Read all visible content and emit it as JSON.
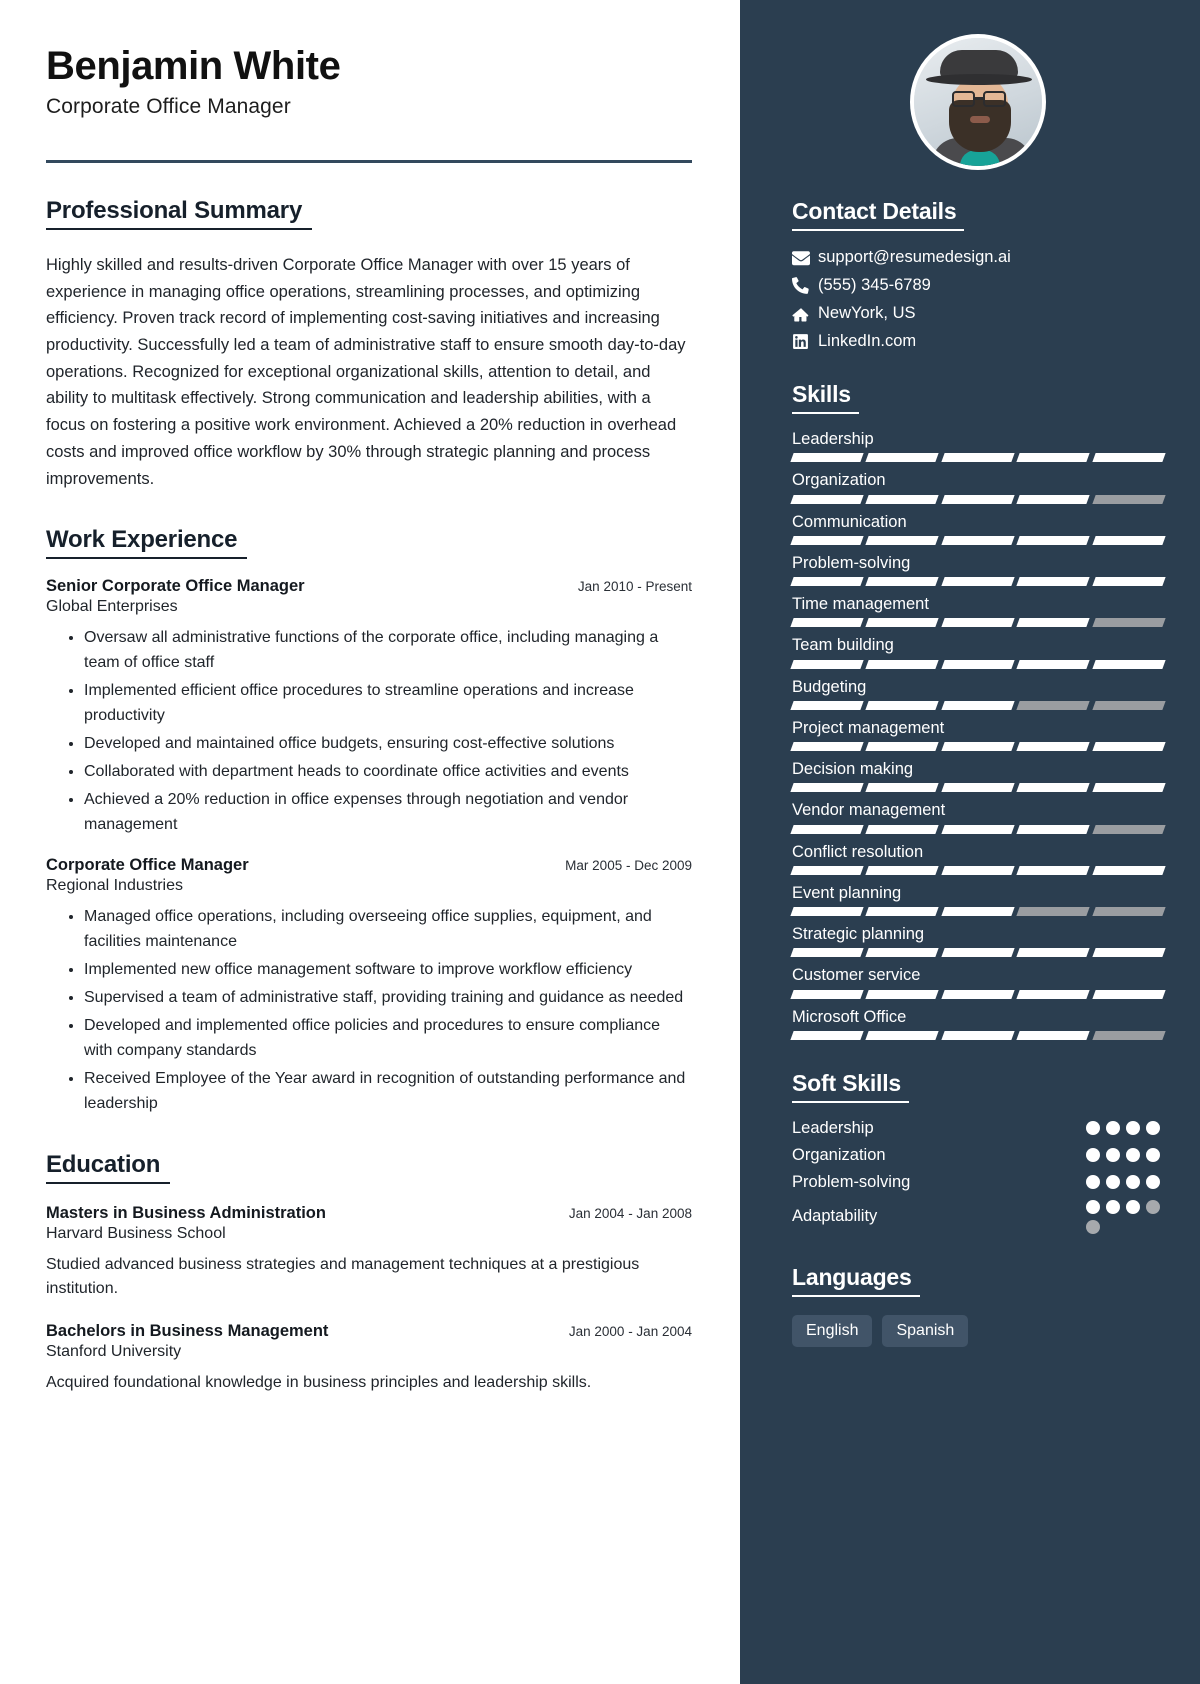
{
  "header": {
    "name": "Benjamin White",
    "job_title": "Corporate Office Manager"
  },
  "summary": {
    "title": "Professional Summary",
    "text": "Highly skilled and results-driven Corporate Office Manager with over 15 years of experience in managing office operations, streamlining processes, and optimizing efficiency. Proven track record of implementing cost-saving initiatives and increasing productivity. Successfully led a team of administrative staff to ensure smooth day-to-day operations. Recognized for exceptional organizational skills, attention to detail, and ability to multitask effectively. Strong communication and leadership abilities, with a focus on fostering a positive work environment. Achieved a 20% reduction in overhead costs and improved office workflow by 30% through strategic planning and process improvements."
  },
  "work": {
    "title": "Work Experience",
    "jobs": [
      {
        "role": "Senior Corporate Office Manager",
        "date": "Jan 2010 - Present",
        "company": "Global Enterprises",
        "bullets": [
          "Oversaw all administrative functions of the corporate office, including managing a team of office staff",
          "Implemented efficient office procedures to streamline operations and increase productivity",
          "Developed and maintained office budgets, ensuring cost-effective solutions",
          "Collaborated with department heads to coordinate office activities and events",
          "Achieved a 20% reduction in office expenses through negotiation and vendor management"
        ]
      },
      {
        "role": "Corporate Office Manager",
        "date": "Mar 2005 - Dec 2009",
        "company": "Regional Industries",
        "bullets": [
          "Managed office operations, including overseeing office supplies, equipment, and facilities maintenance",
          "Implemented new office management software to improve workflow efficiency",
          "Supervised a team of administrative staff, providing training and guidance as needed",
          "Developed and implemented office policies and procedures to ensure compliance with company standards",
          "Received Employee of the Year award in recognition of outstanding performance and leadership"
        ]
      }
    ]
  },
  "education": {
    "title": "Education",
    "items": [
      {
        "degree": "Masters in Business Administration",
        "date": "Jan 2004 - Jan 2008",
        "school": "Harvard Business School",
        "description": "Studied advanced business strategies and management techniques at a prestigious institution."
      },
      {
        "degree": "Bachelors in Business Management",
        "date": "Jan 2000 - Jan 2004",
        "school": "Stanford University",
        "description": "Acquired foundational knowledge in business principles and leadership skills."
      }
    ]
  },
  "sidebar": {
    "contact": {
      "title": "Contact Details",
      "items": [
        {
          "icon": "envelope-icon",
          "value": "support@resumedesign.ai"
        },
        {
          "icon": "phone-icon",
          "value": "(555) 345-6789"
        },
        {
          "icon": "home-icon",
          "value": "NewYork, US"
        },
        {
          "icon": "linkedin-icon",
          "value": "LinkedIn.com"
        }
      ]
    },
    "skills": {
      "title": "Skills",
      "max": 5,
      "items": [
        {
          "label": "Leadership",
          "level": 5
        },
        {
          "label": "Organization",
          "level": 4
        },
        {
          "label": "Communication",
          "level": 5
        },
        {
          "label": "Problem-solving",
          "level": 5
        },
        {
          "label": "Time management",
          "level": 4
        },
        {
          "label": "Team building",
          "level": 5
        },
        {
          "label": "Budgeting",
          "level": 3
        },
        {
          "label": "Project management",
          "level": 5
        },
        {
          "label": "Decision making",
          "level": 5
        },
        {
          "label": "Vendor management",
          "level": 4
        },
        {
          "label": "Conflict resolution",
          "level": 5
        },
        {
          "label": "Event planning",
          "level": 3
        },
        {
          "label": "Strategic planning",
          "level": 5
        },
        {
          "label": "Customer service",
          "level": 5
        },
        {
          "label": "Microsoft Office",
          "level": 4
        }
      ]
    },
    "soft_skills": {
      "title": "Soft Skills",
      "max": 4,
      "items": [
        {
          "label": "Leadership",
          "level": 4,
          "total": 4
        },
        {
          "label": "Organization",
          "level": 4,
          "total": 4
        },
        {
          "label": "Problem-solving",
          "level": 4,
          "total": 4
        },
        {
          "label": "Adaptability",
          "level": 3,
          "total": 5
        }
      ]
    },
    "languages": {
      "title": "Languages",
      "items": [
        "English",
        "Spanish"
      ]
    }
  },
  "colors": {
    "sidebar_bg": "#2b3e50",
    "accent_rule": "#33495d",
    "chip_bg": "#415468",
    "bar_on": "#ffffff",
    "bar_off": "#9a9da1"
  }
}
